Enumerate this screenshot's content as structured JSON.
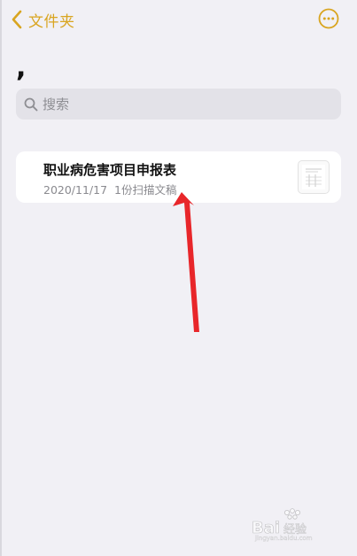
{
  "nav": {
    "back_label": "文件夹"
  },
  "folder": {
    "title": ","
  },
  "search": {
    "placeholder": "搜索"
  },
  "notes": [
    {
      "title": "职业病危害项目申报表",
      "date": "2020/11/17",
      "description": "1份扫描文稿"
    }
  ],
  "colors": {
    "accent": "#d9a520",
    "annotation_arrow": "#e8262a"
  },
  "icons": {
    "back": "chevron-left-icon",
    "more": "ellipsis-circle-icon",
    "search": "magnifier-icon"
  }
}
